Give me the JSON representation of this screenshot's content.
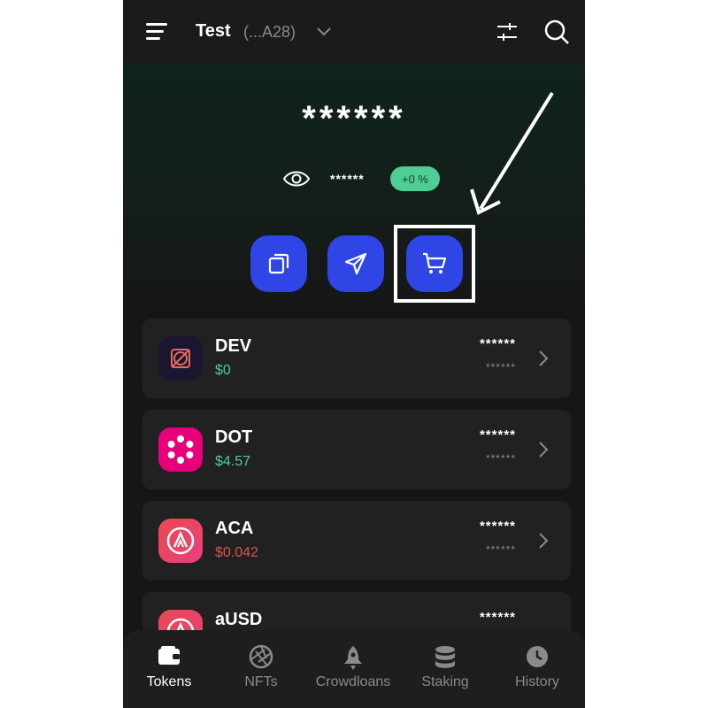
{
  "header": {
    "account_name": "Test",
    "account_address": "(...A28)"
  },
  "balance": {
    "hidden_total": "******",
    "hidden_sub": "******",
    "change": "+0 %"
  },
  "tokens": [
    {
      "symbol": "DEV",
      "price": "$0",
      "price_trend": "up",
      "balance": "******",
      "value": "******"
    },
    {
      "symbol": "DOT",
      "price": "$4.57",
      "price_trend": "up",
      "balance": "******",
      "value": "******"
    },
    {
      "symbol": "ACA",
      "price": "$0.042",
      "price_trend": "down",
      "balance": "******",
      "value": "******"
    },
    {
      "symbol": "aUSD",
      "price": "",
      "price_trend": "",
      "balance": "******",
      "value": ""
    }
  ],
  "nav": [
    {
      "label": "Tokens",
      "icon": "wallet-icon"
    },
    {
      "label": "NFTs",
      "icon": "aperture-icon"
    },
    {
      "label": "Crowdloans",
      "icon": "rocket-icon"
    },
    {
      "label": "Staking",
      "icon": "database-icon"
    },
    {
      "label": "History",
      "icon": "clock-icon"
    }
  ],
  "colors": {
    "accent": "#2f45e6",
    "positive": "#4fce94",
    "negative": "#e24f4f",
    "background": "#161616"
  }
}
